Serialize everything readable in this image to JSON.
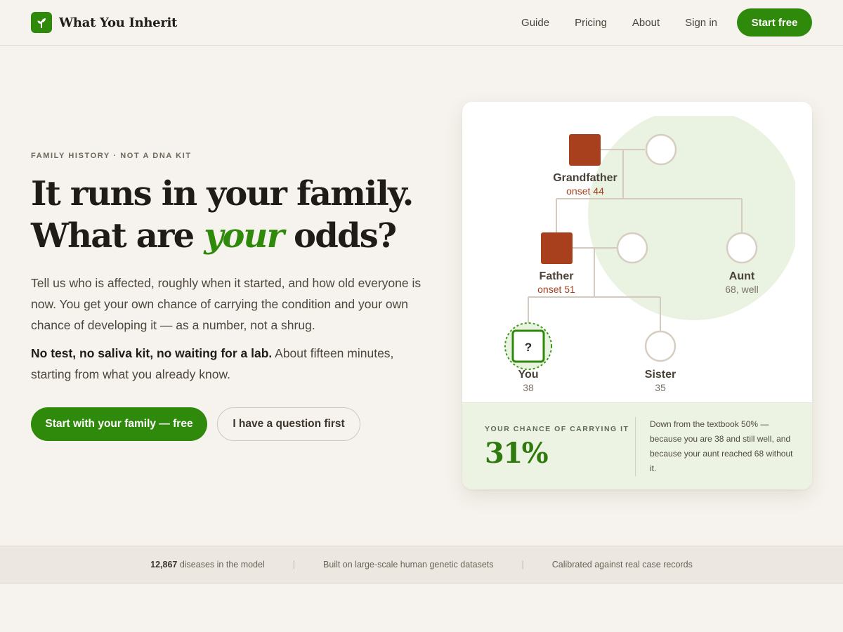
{
  "brand": {
    "name": "What You Inherit",
    "logo_icon": "sprout-icon",
    "accent": "#2f8a0c"
  },
  "nav": {
    "links": [
      "Guide",
      "Pricing",
      "About",
      "Sign in"
    ],
    "cta": "Start free"
  },
  "hero": {
    "eyebrow": "FAMILY HISTORY · NOT A DNA KIT",
    "headline_line1": "It runs in your family.",
    "headline_line2_pre": "What are ",
    "headline_line2_em": "your",
    "headline_line2_post": " odds?",
    "lede": "Tell us who is affected, roughly when it started, and how old everyone is now. You get your own chance of carrying the condition and your own chance of developing it — as a number, not a shrug.",
    "lede2_bold": "No test, no saliva kit, no waiting for a lab.",
    "lede2_rest": " About fifteen minutes, starting from what you already know.",
    "primary_button": "Start with your family — free",
    "secondary_button": "I have a question first"
  },
  "pedigree": {
    "members": {
      "grandfather": {
        "name": "Grandfather",
        "detail": "onset 44",
        "affected": true
      },
      "father": {
        "name": "Father",
        "detail": "onset 51",
        "affected": true
      },
      "aunt": {
        "name": "Aunt",
        "detail": "68, well",
        "affected": false
      },
      "you": {
        "name": "You",
        "detail": "38",
        "marker": "?"
      },
      "sister": {
        "name": "Sister",
        "detail": "35",
        "affected": false
      }
    },
    "colors": {
      "affected": "#a8401e",
      "unaffected_stroke": "#d7cec2",
      "you": "#2f8a0c",
      "halo": "#eaf2e1"
    }
  },
  "result": {
    "label": "YOUR CHANCE OF CARRYING IT",
    "value": "31%",
    "note": "Down from the textbook 50% — because you are 38 and still well, and because your aunt reached 68 without it."
  },
  "stats": {
    "diseases_count": "12,867",
    "diseases_label": " diseases in the model",
    "datasets": "Built on large-scale human genetic datasets",
    "calibrated": "Calibrated against real case records"
  }
}
